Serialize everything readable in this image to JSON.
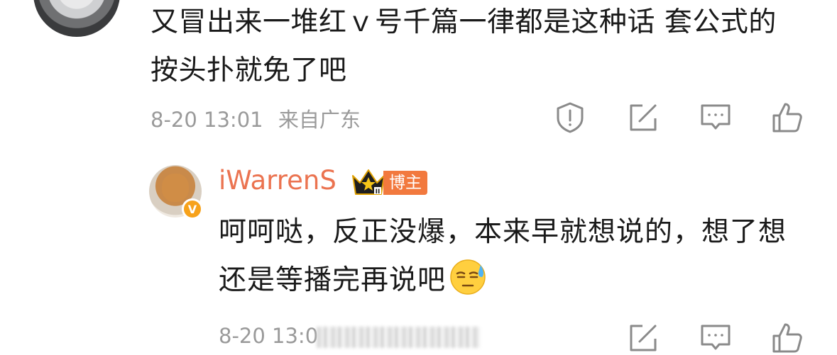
{
  "comment1": {
    "text": "又冒出来一堆红ｖ号千篇一律都是这种话 套公式的按头扑就免了吧",
    "time": "8-20 13:01",
    "location": "来自广东"
  },
  "reply": {
    "username": "iWarrenS",
    "badge_label": "博主",
    "verified_badge": "V",
    "text": "呵呵哒，反正没爆，本来早就想说的，想了想还是等播完再说吧",
    "emoji": "sweat-emoji",
    "time": "8-20 13:0"
  },
  "icons": {
    "report": "report-icon",
    "share": "share-icon",
    "comment": "comment-icon",
    "like": "like-icon"
  }
}
